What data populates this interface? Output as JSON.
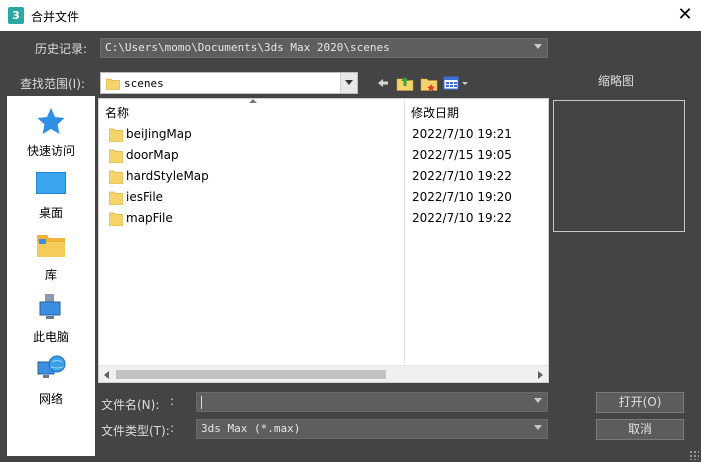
{
  "window": {
    "title": "合并文件",
    "app_icon": "3",
    "close_glyph": "✕"
  },
  "history": {
    "label": "历史记录:",
    "value": "C:\\Users\\momo\\Documents\\3ds Max 2020\\scenes"
  },
  "look_in": {
    "label": "查找范围(I):",
    "value": "scenes"
  },
  "toolbar": {
    "icons": [
      "back-arrow-icon",
      "up-folder-icon",
      "new-folder-icon",
      "view-menu-icon"
    ]
  },
  "places": [
    {
      "label": "快速访问",
      "icon": "star-icon"
    },
    {
      "label": "桌面",
      "icon": "desktop-icon"
    },
    {
      "label": "库",
      "icon": "library-icon"
    },
    {
      "label": "此电脑",
      "icon": "computer-icon"
    },
    {
      "label": "网络",
      "icon": "network-icon"
    }
  ],
  "file_list": {
    "columns": [
      "名称",
      "修改日期"
    ],
    "rows": [
      {
        "name": "beiJingMap",
        "date": "2022/7/10 19:21"
      },
      {
        "name": "doorMap",
        "date": "2022/7/15 19:05"
      },
      {
        "name": "hardStyleMap",
        "date": "2022/7/10 19:22"
      },
      {
        "name": "iesFile",
        "date": "2022/7/10 19:20"
      },
      {
        "name": "mapFile",
        "date": "2022/7/10 19:22"
      }
    ]
  },
  "thumbnail": {
    "label": "缩略图"
  },
  "file_name": {
    "label": "文件名(N):",
    "value": ""
  },
  "file_type": {
    "label": "文件类型(T):",
    "value": "3ds Max (*.max)"
  },
  "buttons": {
    "open": "打开(O)",
    "cancel": "取消"
  },
  "colors": {
    "dialog_bg": "#444444",
    "folder_yellow": "#f5d46b",
    "app_icon": "#2aa9a4"
  }
}
